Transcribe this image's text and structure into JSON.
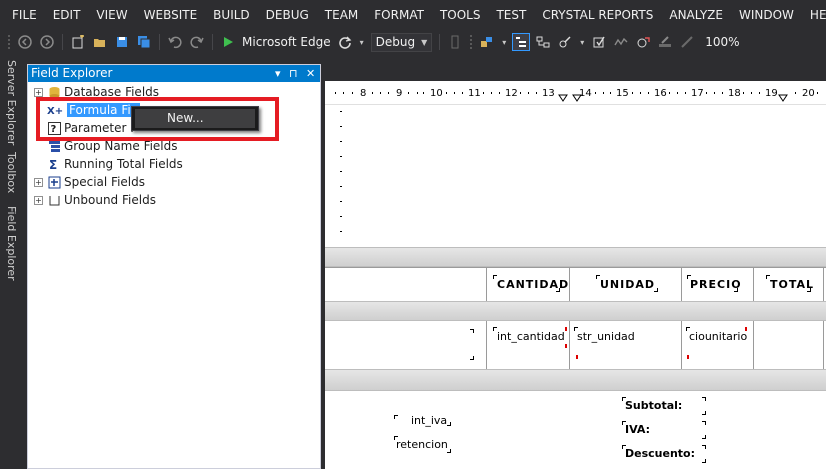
{
  "menu": [
    "FILE",
    "EDIT",
    "VIEW",
    "WEBSITE",
    "BUILD",
    "DEBUG",
    "TEAM",
    "FORMAT",
    "TOOLS",
    "TEST",
    "CRYSTAL REPORTS",
    "ANALYZE",
    "WINDOW",
    "HELP"
  ],
  "toolbar": {
    "browser_label": "Microsoft Edge",
    "config_label": "Debug",
    "zoom_label": "100%",
    "icons": [
      "back-icon",
      "forward-icon",
      "new-project-icon",
      "open-icon",
      "save-icon",
      "save-all-icon",
      "undo-icon",
      "redo-icon",
      "run-icon",
      "refresh-icon"
    ]
  },
  "side_tabs": [
    "Server Explorer",
    "Toolbox",
    "Field Explorer"
  ],
  "field_explorer": {
    "title": "Field Explorer",
    "controls": {
      "dropdown": "▾",
      "pin": "⊓",
      "close": "✕"
    },
    "items": [
      {
        "label": "Database Fields",
        "icon": "database-icon",
        "toggle": "+"
      },
      {
        "label": "Formula Fie",
        "icon": "formula-icon",
        "toggle": ""
      },
      {
        "label": "Parameter F",
        "icon": "parameter-icon",
        "toggle": ""
      },
      {
        "label": "Group Name Fields",
        "icon": "group-name-icon",
        "toggle": ""
      },
      {
        "label": "Running Total Fields",
        "icon": "running-total-icon",
        "toggle": ""
      },
      {
        "label": "Special Fields",
        "icon": "special-fields-icon",
        "toggle": "+"
      },
      {
        "label": "Unbound Fields",
        "icon": "unbound-fields-icon",
        "toggle": "+"
      }
    ]
  },
  "context_menu": {
    "items": [
      "New..."
    ]
  },
  "ruler": {
    "numbers": [
      "8",
      "9",
      "10",
      "11",
      "12",
      "13",
      "14",
      "15",
      "16",
      "17",
      "18",
      "19",
      "20"
    ]
  },
  "report": {
    "headers": [
      "CANTIDAD",
      "UNIDAD",
      "PRECIO",
      "TOTAL"
    ],
    "details": [
      "int_cantidad",
      "str_unidad",
      "ciounitario"
    ],
    "footer_fields": [
      "int_iva",
      "retencion"
    ],
    "footer_labels": [
      "Subtotal:",
      "IVA:",
      "Descuento:"
    ]
  },
  "colors": {
    "accent": "#007acc",
    "highlight_box": "#e51c23",
    "selection": "#3399ff"
  }
}
